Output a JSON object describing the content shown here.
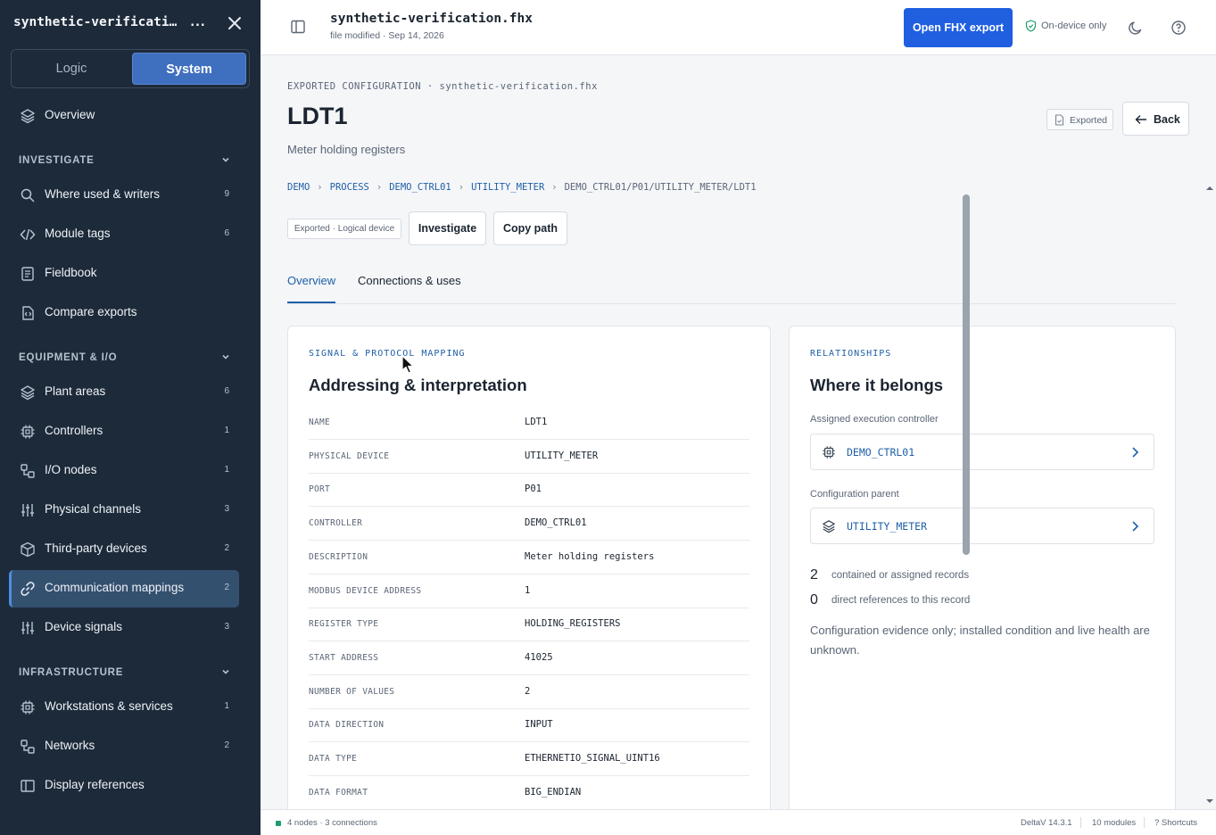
{
  "sidebar": {
    "title": "synthetic-verification.fhx",
    "more_label": "...",
    "segments": {
      "logic": "Logic",
      "system": "System"
    },
    "overview": {
      "label": "Overview",
      "icon": "layers-icon"
    },
    "sections": [
      {
        "title": "INVESTIGATE"
      },
      {
        "title": "EQUIPMENT & I/O"
      },
      {
        "title": "INFRASTRUCTURE"
      }
    ],
    "investigate": [
      {
        "label": "Where used & writers",
        "count": "9",
        "icon": "search-icon"
      },
      {
        "label": "Module tags",
        "count": "6",
        "icon": "code-icon"
      },
      {
        "label": "Fieldbook",
        "count": "",
        "icon": "notebook-icon"
      },
      {
        "label": "Compare exports",
        "count": "",
        "icon": "compare-icon"
      }
    ],
    "equipment": [
      {
        "label": "Plant areas",
        "count": "6",
        "icon": "layers-icon"
      },
      {
        "label": "Controllers",
        "count": "1",
        "icon": "chip-icon"
      },
      {
        "label": "I/O nodes",
        "count": "1",
        "icon": "nodes-icon"
      },
      {
        "label": "Physical channels",
        "count": "3",
        "icon": "sliders-icon"
      },
      {
        "label": "Third-party devices",
        "count": "2",
        "icon": "box-icon"
      },
      {
        "label": "Communication mappings",
        "count": "2",
        "icon": "link-icon",
        "active": true
      },
      {
        "label": "Device signals",
        "count": "3",
        "icon": "sliders-icon"
      }
    ],
    "infrastructure": [
      {
        "label": "Workstations & services",
        "count": "1",
        "icon": "chip-icon"
      },
      {
        "label": "Networks",
        "count": "2",
        "icon": "nodes-icon"
      },
      {
        "label": "Display references",
        "count": "",
        "icon": "panel-icon"
      }
    ]
  },
  "topbar": {
    "file_name": "synthetic-verification.fhx",
    "file_meta": "file modified · Sep 14, 2026",
    "open_button": "Open FHX export",
    "on_device": "On-device only"
  },
  "page": {
    "eyebrow": "EXPORTED CONFIGURATION · synthetic-verification.fhx",
    "title": "LDT1",
    "subtitle": "Meter holding registers",
    "exported_badge": "Exported",
    "back_button": "Back",
    "breadcrumb": {
      "items": [
        "DEMO",
        "PROCESS",
        "DEMO_CTRL01",
        "UTILITY_METER"
      ],
      "current": "DEMO_CTRL01/P01/UTILITY_METER/LDT1",
      "separator": "›"
    },
    "pill": "Exported · Logical device",
    "actions": {
      "investigate": "Investigate",
      "copy_path": "Copy path"
    },
    "tabs": [
      "Overview",
      "Connections & uses"
    ]
  },
  "mapping_card": {
    "eyebrow": "SIGNAL & PROTOCOL MAPPING",
    "title": "Addressing & interpretation",
    "rows": [
      {
        "key": "NAME",
        "value": "LDT1"
      },
      {
        "key": "PHYSICAL DEVICE",
        "value": "UTILITY_METER"
      },
      {
        "key": "PORT",
        "value": "P01"
      },
      {
        "key": "CONTROLLER",
        "value": "DEMO_CTRL01"
      },
      {
        "key": "DESCRIPTION",
        "value": "Meter holding registers"
      },
      {
        "key": "MODBUS DEVICE ADDRESS",
        "value": "1"
      },
      {
        "key": "REGISTER TYPE",
        "value": "HOLDING_REGISTERS"
      },
      {
        "key": "START ADDRESS",
        "value": "41025"
      },
      {
        "key": "NUMBER OF VALUES",
        "value": "2"
      },
      {
        "key": "DATA DIRECTION",
        "value": "INPUT"
      },
      {
        "key": "DATA TYPE",
        "value": "ETHERNETIO_SIGNAL_UINT16"
      },
      {
        "key": "DATA FORMAT",
        "value": "BIG_ENDIAN"
      }
    ]
  },
  "relationships_card": {
    "eyebrow": "RELATIONSHIPS",
    "title": "Where it belongs",
    "controller_label": "Assigned execution controller",
    "controller_value": "DEMO_CTRL01",
    "parent_label": "Configuration parent",
    "parent_value": "UTILITY_METER",
    "stats": [
      {
        "num": "2",
        "text": "contained or assigned records"
      },
      {
        "num": "0",
        "text": "direct references to this record"
      }
    ],
    "note": "Configuration evidence only; installed condition and live health are unknown."
  },
  "statusbar": {
    "left": "4 nodes · 3 connections",
    "version": "DeltaV 14.3.1",
    "modules": "10 modules",
    "shortcuts": "? Shortcuts"
  },
  "colors": {
    "accent": "#1f5fe0",
    "sidebar_bg": "#1d2a3a",
    "link": "#1f5fa8",
    "status_ok": "#1f9d6b"
  }
}
